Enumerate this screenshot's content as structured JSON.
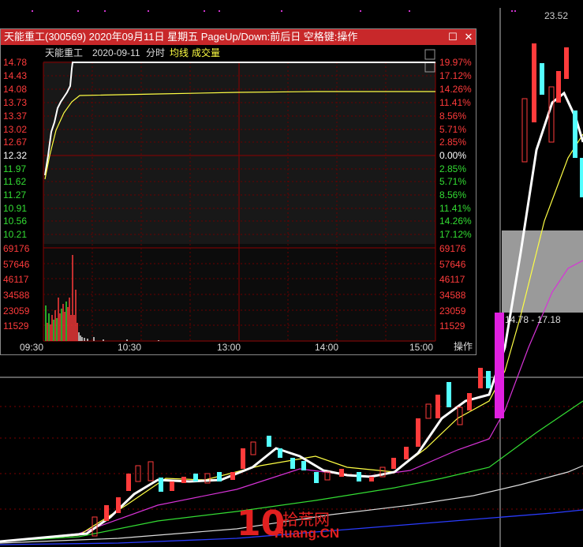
{
  "window": {
    "title": "天能重工(300569)  2020年09月11日  星期五  PageUp/Down:前后日  空格键:操作",
    "restore_icon": "restore-icon",
    "close_icon": "close-icon"
  },
  "subheader": {
    "stock_name": "天能重工",
    "date": "2020-09-11",
    "mode": "分时",
    "avg_line": "均线",
    "volume": "成交量"
  },
  "price_axis": [
    "14.78",
    "14.43",
    "14.08",
    "13.73",
    "13.37",
    "13.02",
    "12.67",
    "12.32",
    "11.97",
    "11.62",
    "11.27",
    "10.91",
    "10.56",
    "10.21"
  ],
  "pct_axis": [
    "19.97%",
    "17.12%",
    "14.26%",
    "11.41%",
    "8.56%",
    "5.71%",
    "2.85%",
    "0.00%",
    "2.85%",
    "5.71%",
    "8.56%",
    "11.41%",
    "14.26%",
    "17.12%"
  ],
  "volume_axis": [
    "69176",
    "57646",
    "46117",
    "34588",
    "23059",
    "11529"
  ],
  "time_axis": [
    "09:30",
    "10:30",
    "13:00",
    "14:00",
    "15:00"
  ],
  "operate_button": "操作",
  "main_chart": {
    "top_price": "23.52",
    "range_label": "14.78 - 17.18"
  },
  "watermark": {
    "number": "10",
    "cn": "拾荒网",
    "en": "Huang.CN"
  },
  "colors": {
    "up": "#ff3b3b",
    "down": "#54ffff",
    "avg": "#ffff00",
    "grid": "#8b0000",
    "title_bg": "#c8282a"
  }
}
